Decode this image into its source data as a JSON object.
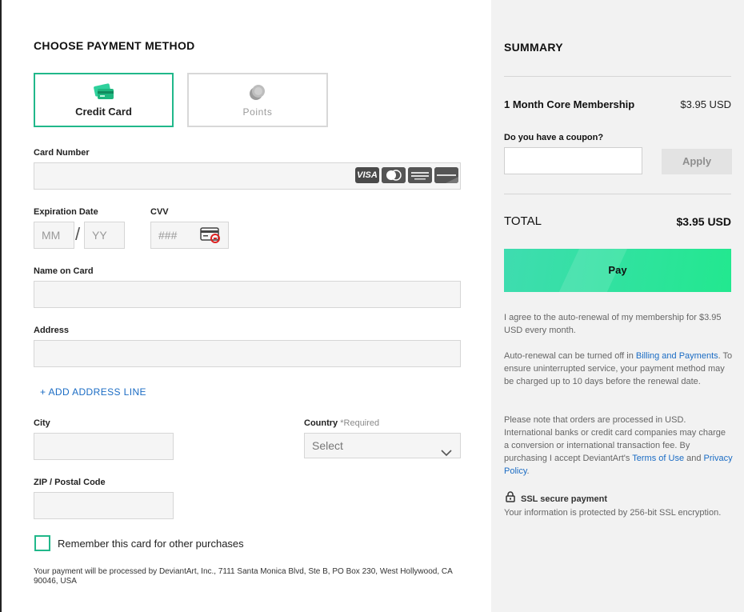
{
  "payment": {
    "heading": "CHOOSE PAYMENT METHOD",
    "methods": [
      {
        "label": "Credit Card",
        "selected": true,
        "icon": "credit-card-icon"
      },
      {
        "label": "Points",
        "selected": false,
        "icon": "points-icon"
      }
    ],
    "card_number_label": "Card Number",
    "card_number_value": "",
    "card_brands": [
      "VISA",
      "MasterCard",
      "AMERICAN EXPRESS",
      "DISCOVER"
    ],
    "expiration_label": "Expiration Date",
    "exp_month_placeholder": "MM",
    "exp_separator": "/",
    "exp_year_placeholder": "YY",
    "cvv_label": "CVV",
    "cvv_placeholder": "###",
    "name_label": "Name on Card",
    "address_label": "Address",
    "add_address_line": "+ ADD ADDRESS LINE",
    "city_label": "City",
    "country_label": "Country",
    "country_required": "*Required",
    "country_selected": "Select",
    "zip_label": "ZIP / Postal Code",
    "remember_label": "Remember this card for other purchases",
    "remember_checked": false,
    "processed_note": "Your payment will be processed by DeviantArt, Inc., 7111 Santa Monica Blvd, Ste B, PO Box 230, West Hollywood, CA 90046, USA"
  },
  "summary": {
    "heading": "SUMMARY",
    "item_name": "1 Month Core Membership",
    "item_price": "$3.95 USD",
    "coupon_label": "Do you have a coupon?",
    "apply_label": "Apply",
    "total_label": "TOTAL",
    "total_amount": "$3.95 USD",
    "pay_label": "Pay",
    "agree_text": "I agree to the auto-renewal of my membership for $3.95 USD every month.",
    "renewal_prefix": "Auto-renewal can be turned off in ",
    "renewal_link": "Billing and Payments",
    "renewal_suffix": ". To ensure uninterrupted service, your payment method may be charged up to 10 days before the renewal date.",
    "usd_prefix": "Please note that orders are processed in USD. International banks or credit card companies may charge a conversion or international transaction fee. By purchasing I accept DeviantArt's ",
    "terms_link": "Terms of Use",
    "and_text": " and ",
    "privacy_link": "Privacy Policy",
    "period": ".",
    "ssl_title": "SSL secure payment",
    "ssl_text": "Your information is protected by 256-bit SSL encryption."
  },
  "colors": {
    "accent_green": "#21b88a",
    "link_blue": "#1b6cc4",
    "pay_gradient_start": "#3fdcb0",
    "pay_gradient_end": "#22e88f"
  }
}
